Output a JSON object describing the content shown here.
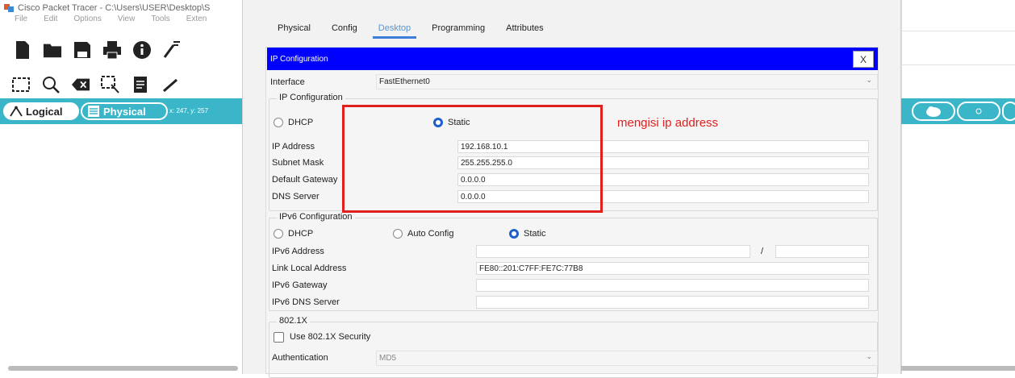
{
  "app": {
    "title": "Cisco Packet Tracer - C:\\Users\\USER\\Desktop\\S",
    "menu": [
      "File",
      "Edit",
      "Options",
      "View",
      "Tools",
      "Exten"
    ],
    "toolbar_icons": [
      "new-file-icon",
      "open-folder-icon",
      "save-icon",
      "print-icon",
      "info-icon",
      "network-wizard-icon"
    ],
    "toolbar2_icons": [
      "select-icon",
      "zoom-icon",
      "delete-icon",
      "resize-icon",
      "note-icon",
      "draw-line-icon"
    ],
    "view": {
      "logical_label": "Logical",
      "physical_label": "Physical",
      "coords": "x: 247, y: 257"
    },
    "accent": "#3bb6c9"
  },
  "dialog": {
    "tabs": [
      "Physical",
      "Config",
      "Desktop",
      "Programming",
      "Attributes"
    ],
    "active_tab": "Desktop",
    "ip_config_title": "IP Configuration",
    "close_label": "X",
    "interface_label": "Interface",
    "interface_value": "FastEthernet0",
    "ipv4": {
      "group_title": "IP Configuration",
      "dhcp_label": "DHCP",
      "static_label": "Static",
      "mode": "Static",
      "fields": [
        {
          "label": "IP Address",
          "value": "192.168.10.1"
        },
        {
          "label": "Subnet Mask",
          "value": "255.255.255.0"
        },
        {
          "label": "Default Gateway",
          "value": "0.0.0.0"
        },
        {
          "label": "DNS Server",
          "value": "0.0.0.0"
        }
      ]
    },
    "ipv6": {
      "group_title": "IPv6 Configuration",
      "dhcp_label": "DHCP",
      "auto_label": "Auto Config",
      "static_label": "Static",
      "mode": "Static",
      "address_label": "IPv6 Address",
      "address_value": "",
      "prefix_sep": "/",
      "prefix_value": "",
      "link_local_label": "Link Local Address",
      "link_local_value": "FE80::201:C7FF:FE7C:77B8",
      "gateway_label": "IPv6 Gateway",
      "gateway_value": "",
      "dns_label": "IPv6 DNS Server",
      "dns_value": ""
    },
    "dot1x": {
      "group_title": "802.1X",
      "use_label": "Use 802.1X Security",
      "checked": false,
      "auth_label": "Authentication",
      "auth_value": "MD5"
    }
  },
  "annotation": {
    "text": "mengisi ip address",
    "color": "#e0201e"
  }
}
